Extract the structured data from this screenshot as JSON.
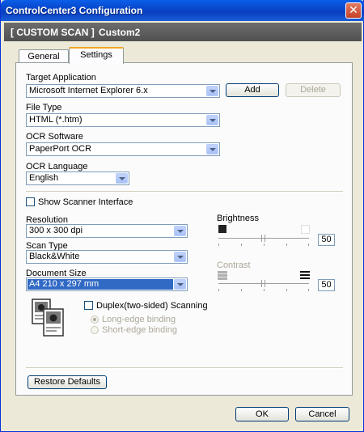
{
  "window": {
    "title": "ControlCenter3 Configuration"
  },
  "banner": {
    "left": "[ CUSTOM SCAN ]",
    "right": "Custom2"
  },
  "tabs": [
    {
      "label": "General"
    },
    {
      "label": "Settings"
    }
  ],
  "target_app": {
    "label": "Target Application",
    "value": "Microsoft Internet Explorer 6.x",
    "add": "Add",
    "delete": "Delete"
  },
  "file_type": {
    "label": "File Type",
    "value": "HTML (*.htm)"
  },
  "ocr_software": {
    "label": "OCR Software",
    "value": "PaperPort OCR"
  },
  "ocr_language": {
    "label": "OCR Language",
    "value": "English"
  },
  "show_scanner": {
    "label": "Show Scanner Interface",
    "checked": false
  },
  "resolution": {
    "label": "Resolution",
    "value": "300 x 300 dpi"
  },
  "scan_type": {
    "label": "Scan Type",
    "value": "Black&White"
  },
  "document_size": {
    "label": "Document Size",
    "value": "A4 210 x 297 mm"
  },
  "duplex": {
    "label": "Duplex(two-sided) Scanning",
    "checked": false,
    "long_edge": "Long-edge binding",
    "short_edge": "Short-edge binding"
  },
  "brightness": {
    "label": "Brightness",
    "value": "50"
  },
  "contrast": {
    "label": "Contrast",
    "value": "50"
  },
  "buttons": {
    "restore": "Restore Defaults",
    "ok": "OK",
    "cancel": "Cancel"
  },
  "colors": {
    "titlebar": "#0845c8",
    "banner": "#5a5a5a",
    "selection": "#316ac5",
    "tab_accent": "#f5a623"
  }
}
